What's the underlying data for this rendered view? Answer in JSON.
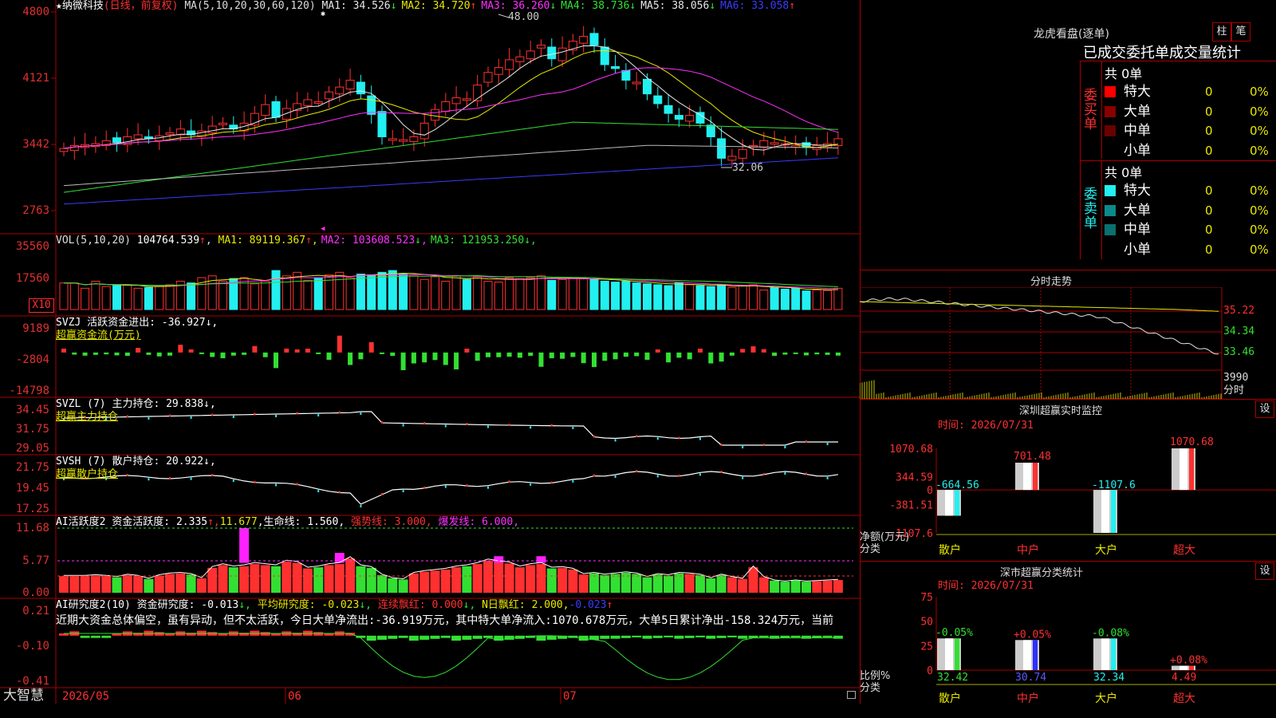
{
  "header": {
    "star": "★",
    "stock_name": "纳微科技",
    "mode": "(日线，前复权)",
    "ma_prefix": "MA(5,10,20,30,60,120)",
    "ma_values": [
      {
        "label": "MA1:",
        "value": "34.526",
        "arrow": "↓",
        "color": "#e6e6e6"
      },
      {
        "label": "MA2:",
        "value": "34.720",
        "arrow": "↑",
        "color": "#e8e800"
      },
      {
        "label": "MA3:",
        "value": "36.260",
        "arrow": "↓",
        "color": "#ff30ff"
      },
      {
        "label": "MA4:",
        "value": "38.736",
        "arrow": "↓",
        "color": "#32e032"
      },
      {
        "label": "MA5:",
        "value": "38.056",
        "arrow": "↓",
        "color": "#e6e6e6"
      },
      {
        "label": "MA6:",
        "value": "33.058",
        "arrow": "↑",
        "color": "#3a3aff"
      }
    ],
    "high_marker": "48.00",
    "low_marker": "32.06"
  },
  "price_axis": [
    "4800",
    "4121",
    "3442",
    "2763"
  ],
  "vol": {
    "header": "VOL(5,10,20)",
    "value": "104764.539",
    "arrow": "↑",
    "ma": [
      {
        "label": "MA1:",
        "value": "89119.367",
        "arrow": "↑",
        "color": "#e8e800"
      },
      {
        "label": "MA2:",
        "value": "103608.523",
        "arrow": "↓",
        "color": "#ff30ff"
      },
      {
        "label": "MA3:",
        "value": "121953.250",
        "arrow": "↓",
        "color": "#32e032"
      }
    ],
    "axis": [
      "35560",
      "17560"
    ],
    "unit": "X10"
  },
  "svzj": {
    "line1": "SVZJ  活跃资金进出: -36.927↓,",
    "line2": "超赢资金流(万元)",
    "axis": [
      "9189",
      "-2804",
      "-14798"
    ]
  },
  "svzl": {
    "line1": "SVZL (7) 主力持仓: 29.838↓,",
    "line2": "超赢主力持仓",
    "axis": [
      "34.45",
      "31.75",
      "29.05"
    ]
  },
  "svsh": {
    "line1": "SVSH (7) 散户持仓: 20.922↓,",
    "line2": "超赢散户持仓",
    "axis": [
      "21.75",
      "19.45",
      "17.25"
    ]
  },
  "ai1": {
    "prefix": "AI活跃度2 资金活跃度: 2.335",
    "v2": "11.677",
    "v3": ",生命线: 1.560,",
    "v4": "强势线: 3.000,",
    "v5": "爆发线: 6.000,",
    "axis": [
      "11.68",
      "5.77",
      "0.00"
    ]
  },
  "ai2": {
    "prefix": "AI研究度2(10) 资金研究度: -0.013",
    "v2": "平均研究度: -0.023",
    "v3": "连续飘红: 0.000",
    "v4": "N日飘红: 2.000,",
    "v5": "-0.023",
    "commentary": "近期大资金总体偏空，虽有异动，但不太活跃，今日大单净流出:-36.919万元，其中特大单净流入:1070.678万元，大单5日累计净出-158.324万元，当前",
    "axis": [
      "0.21",
      "-0.10",
      "-0.41"
    ]
  },
  "footer": {
    "logo": "大智慧",
    "dates": [
      "2026/05",
      "06",
      "07"
    ]
  },
  "dragon": {
    "title": "龙虎看盘(逐单)",
    "btn_bar": "柱",
    "btn_pen": "笔",
    "subtitle": "已成交委托单成交量统计",
    "buy_label": "委买单",
    "sell_label": "委卖单",
    "buy_total": "共 0单",
    "sell_total": "共 0单",
    "buy_rows": [
      {
        "name": "特大",
        "count": "0",
        "pct": "0%",
        "color": "#ff0000"
      },
      {
        "name": "大单",
        "count": "0",
        "pct": "0%",
        "color": "#8a0000"
      },
      {
        "name": "中单",
        "count": "0",
        "pct": "0%",
        "color": "#6a0000"
      },
      {
        "name": "小单",
        "count": "0",
        "pct": "0%",
        "color": ""
      }
    ],
    "sell_rows": [
      {
        "name": "特大",
        "count": "0",
        "pct": "0%",
        "color": "#22f0f0"
      },
      {
        "name": "大单",
        "count": "0",
        "pct": "0%",
        "color": "#0a8a8a"
      },
      {
        "name": "中单",
        "count": "0",
        "pct": "0%",
        "color": "#0a7070"
      },
      {
        "name": "小单",
        "count": "0",
        "pct": "0%",
        "color": ""
      }
    ]
  },
  "intraday": {
    "title": "分时走势",
    "price_labels": [
      "35.22",
      "34.34",
      "33.46"
    ],
    "vol_label": "3990",
    "unit_label": "分时"
  },
  "monitor": {
    "title": "深圳超赢实时监控",
    "btn": "设",
    "time": "时间: 2026/07/31",
    "axis": [
      "1070.68",
      "344.59",
      "0",
      "-381.51",
      "-1107.6"
    ],
    "side_label1": "净额(万元)",
    "side_label2": "分类",
    "bars": [
      {
        "cat": "散户",
        "value": -664.56,
        "label": "-664.56",
        "color": "#22f0f0"
      },
      {
        "cat": "中户",
        "value": 701.48,
        "label": "701.48",
        "color": "#ff3030"
      },
      {
        "cat": "大户",
        "value": -1107.6,
        "label": "-1107.6",
        "color": "#22f0f0"
      },
      {
        "cat": "超大",
        "value": 1070.68,
        "label": "1070.68",
        "color": "#ff3030"
      }
    ]
  },
  "classify": {
    "title": "深市超赢分类统计",
    "btn": "设",
    "time": "时间: 2026/07/31",
    "axis": [
      "75",
      "50",
      "25",
      "0"
    ],
    "side_label1": "比例%",
    "side_label2": "分类",
    "bars": [
      {
        "cat": "散户",
        "value": 32.42,
        "label": "32.42",
        "delta": "-0.05%",
        "color": "#32e032",
        "delta_color": "#32e032"
      },
      {
        "cat": "中户",
        "value": 30.74,
        "label": "30.74",
        "delta": "+0.05%",
        "color": "#3030ff",
        "delta_color": "#ff3030"
      },
      {
        "cat": "大户",
        "value": 32.34,
        "label": "32.34",
        "delta": "-0.08%",
        "color": "#22f0f0",
        "delta_color": "#32e032"
      },
      {
        "cat": "超大",
        "value": 4.49,
        "label": "4.49",
        "delta": "+0.08%",
        "color": "#ff3030",
        "delta_color": "#ff3030"
      }
    ]
  },
  "colors": {
    "up": "#ff3030",
    "down": "#22f0f0",
    "panel_border": "#a00000"
  },
  "chart_data": [
    {
      "type": "bar",
      "title": "SVZJ 活跃资金进出",
      "ylim": [
        -14798,
        9189
      ],
      "values": [
        1500,
        -800,
        -1200,
        -900,
        -700,
        -1100,
        -1300,
        1800,
        -900,
        -1500,
        -1200,
        3000,
        1200,
        -500,
        -1700,
        -2200,
        -1200,
        -900,
        2500,
        -1800,
        -6000,
        1500,
        1200,
        1500,
        -500,
        -2800,
        6500,
        -4800,
        -2600,
        4000,
        -600,
        -1300,
        -6800,
        -4200,
        -3800,
        -2900,
        -4800,
        -6500,
        1500,
        -3200,
        -1800,
        -1800,
        -1600,
        -2000,
        -1300,
        -5500,
        -2200,
        -2400,
        -1700,
        -4100,
        -5600,
        -3200,
        -2600,
        -1600,
        -1400,
        -2800,
        1200,
        -3800,
        -2000,
        -2600,
        1500,
        -4200,
        -3500,
        -1200,
        1400,
        2400,
        1300,
        -1300,
        -800,
        -600,
        -1100,
        -700,
        -900,
        -1200
      ]
    },
    {
      "type": "bar",
      "title": "VOL",
      "ylim": [
        0,
        35560
      ],
      "values": [
        15000,
        15000,
        12000,
        16000,
        13000,
        13500,
        14000,
        12000,
        12500,
        13000,
        14000,
        16000,
        15000,
        18000,
        19000,
        16000,
        17500,
        18000,
        14500,
        16000,
        22000,
        19000,
        21000,
        16500,
        18000,
        19500,
        21000,
        18000,
        20000,
        19500,
        21000,
        22000,
        20000,
        19000,
        17000,
        18500,
        16000,
        19000,
        17000,
        18500,
        16000,
        15500,
        18000,
        17500,
        18000,
        19000,
        16500,
        17000,
        18000,
        17500,
        17000,
        16000,
        15500,
        16000,
        15000,
        14500,
        14000,
        13500,
        15000,
        14000,
        13500,
        13000,
        14000,
        12500,
        13500,
        14000,
        11000,
        12500,
        11500,
        12000,
        10500,
        11000,
        10800,
        12000
      ]
    }
  ]
}
